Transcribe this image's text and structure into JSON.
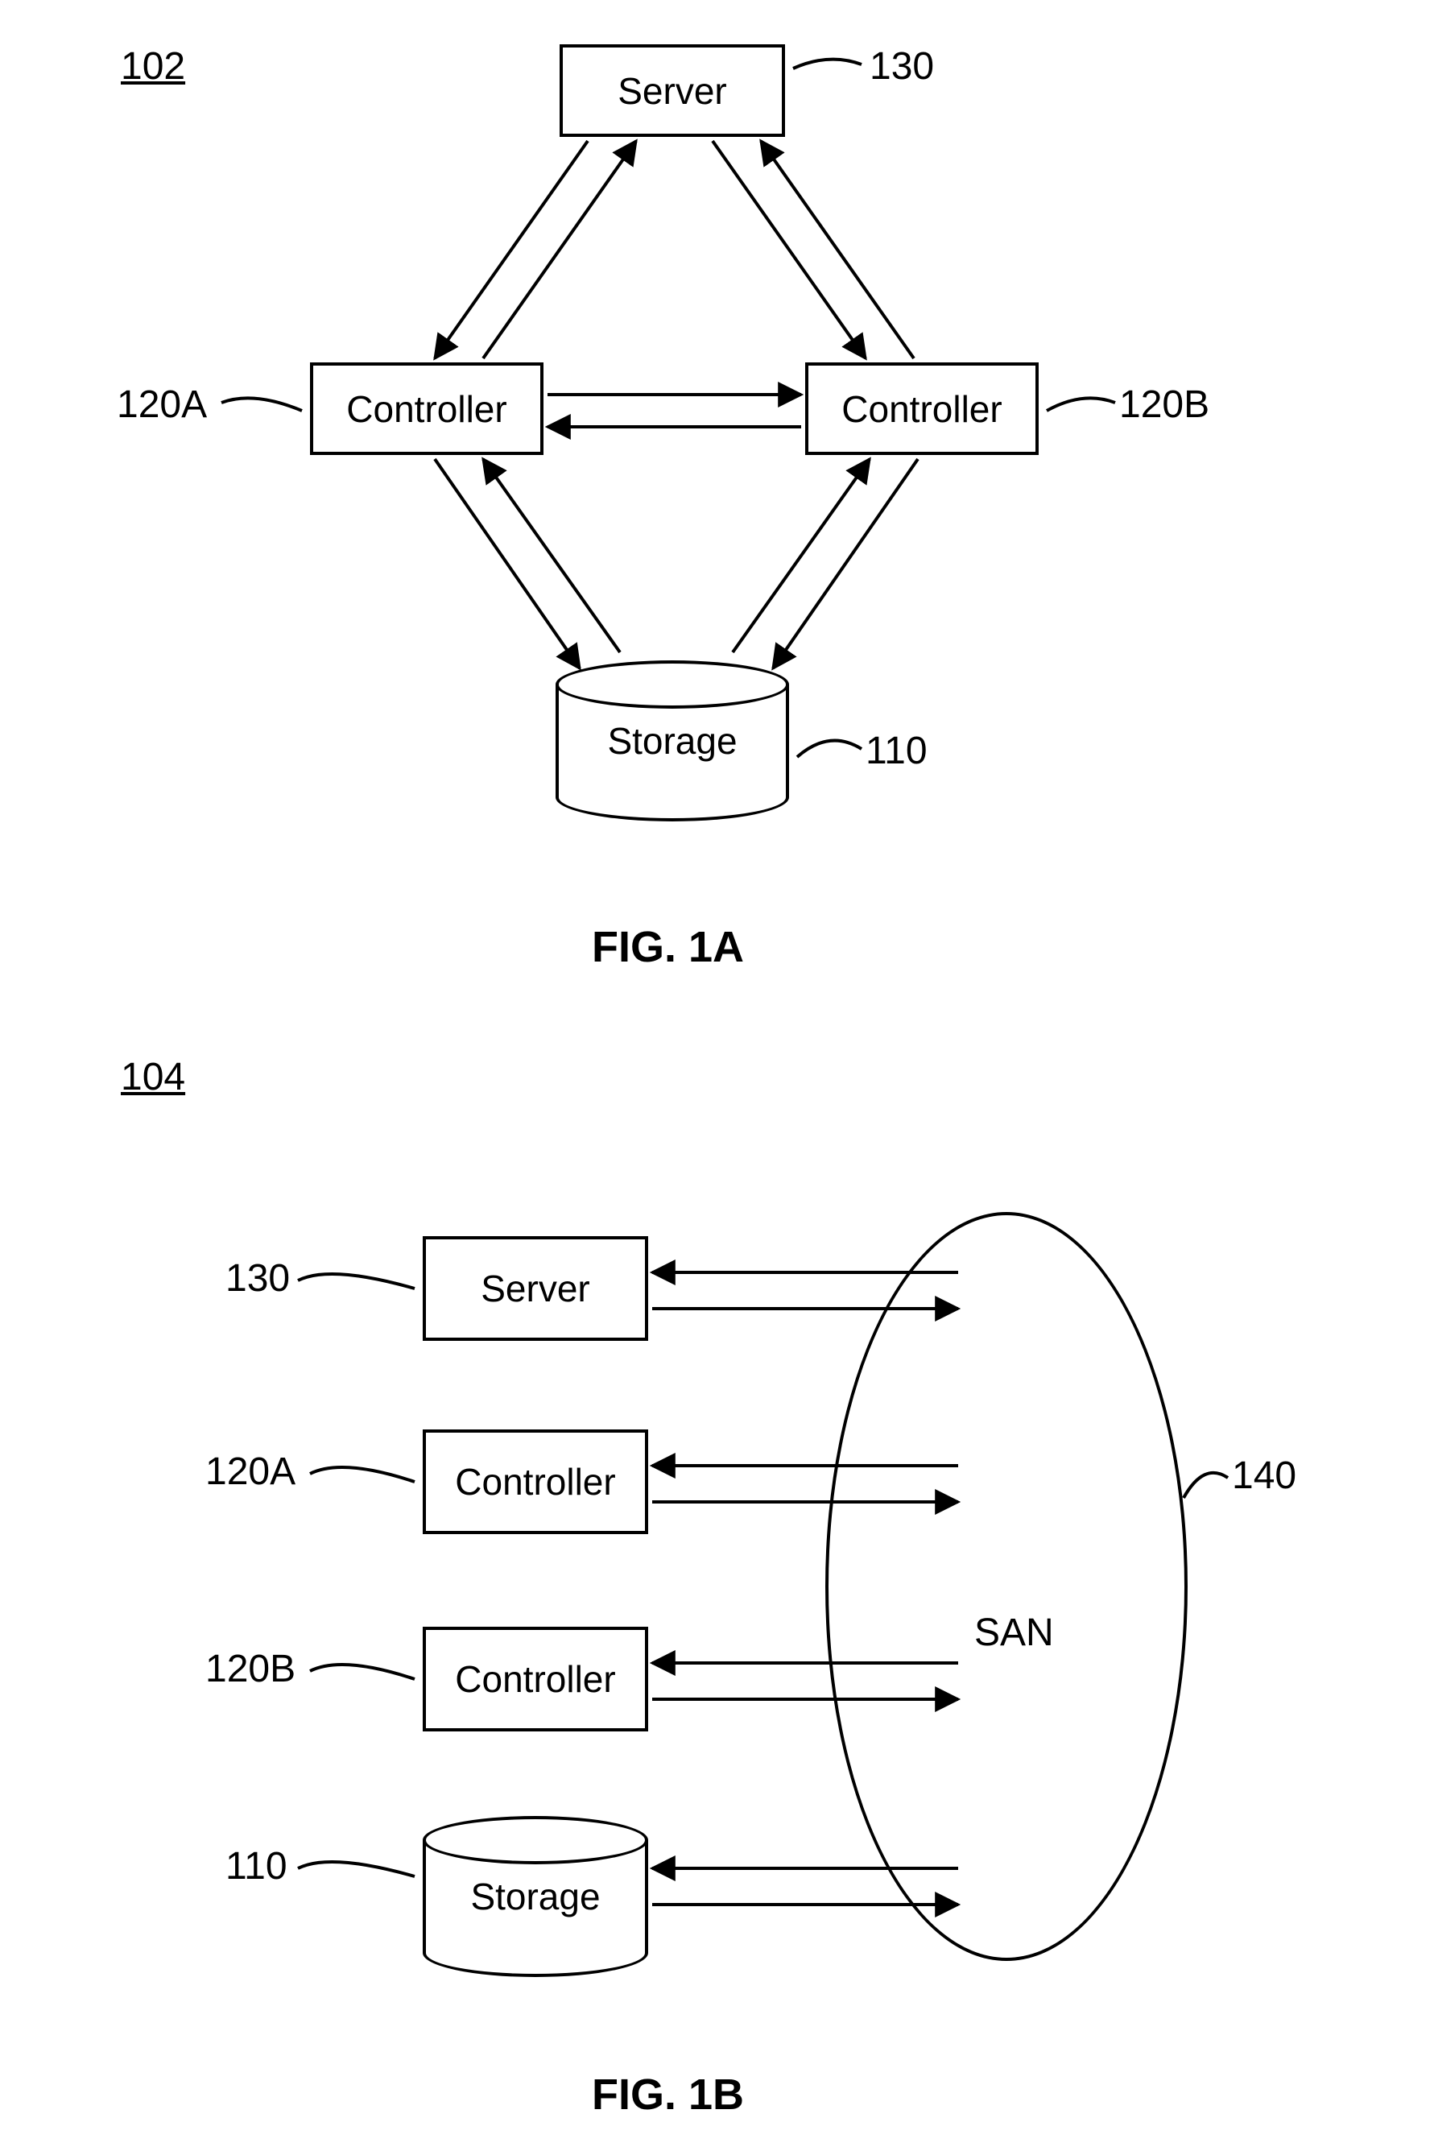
{
  "figA": {
    "ref": "102",
    "caption": "FIG. 1A",
    "nodes": {
      "server": {
        "label": "Server",
        "callout": "130"
      },
      "controllerA": {
        "label": "Controller",
        "callout": "120A"
      },
      "controllerB": {
        "label": "Controller",
        "callout": "120B"
      },
      "storage": {
        "label": "Storage",
        "callout": "110"
      }
    }
  },
  "figB": {
    "ref": "104",
    "caption": "FIG. 1B",
    "san": {
      "label": "SAN",
      "callout": "140"
    },
    "nodes": {
      "server": {
        "label": "Server",
        "callout": "130"
      },
      "controllerA": {
        "label": "Controller",
        "callout": "120A"
      },
      "controllerB": {
        "label": "Controller",
        "callout": "120B"
      },
      "storage": {
        "label": "Storage",
        "callout": "110"
      }
    }
  }
}
